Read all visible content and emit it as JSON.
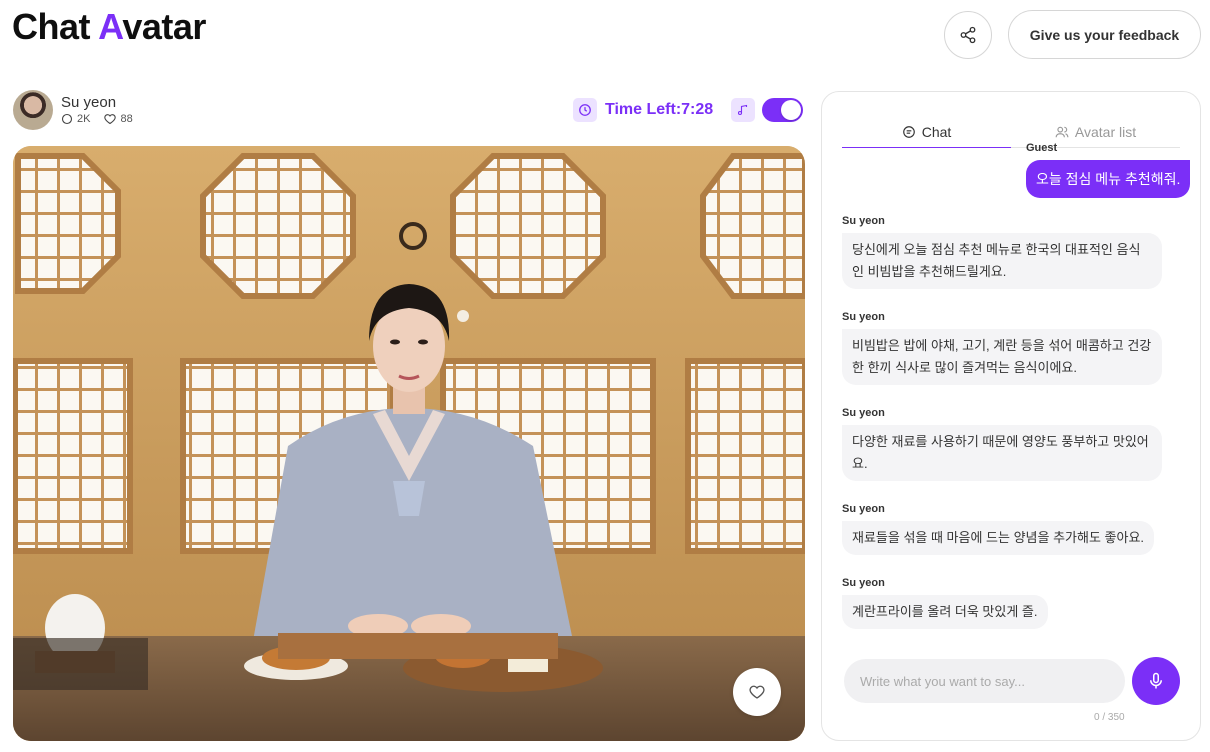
{
  "header": {
    "logo_part1": "Chat ",
    "logo_accent": "A",
    "logo_part2": "vatar",
    "feedback_label": "Give us your feedback"
  },
  "avatar": {
    "name": "Su yeon",
    "chats": "2K",
    "likes": "88"
  },
  "session": {
    "time_left": "Time Left:7:28",
    "music_toggle_on": true
  },
  "chat": {
    "tabs": [
      "Chat",
      "Avatar list"
    ],
    "active_tab": "Chat",
    "messages": [
      {
        "sender": "Guest",
        "text": "오늘 점심 메뉴 추천해줘."
      },
      {
        "sender": "Su yeon",
        "text": "당신에게 오늘 점심 추천 메뉴로 한국의 대표적인 음식인 비빔밥을 추천해드릴게요."
      },
      {
        "sender": "Su yeon",
        "text": "비빔밥은 밥에 야채, 고기, 계란 등을 섞어 매콤하고 건강한 한끼 식사로 많이 즐겨먹는 음식이에요."
      },
      {
        "sender": "Su yeon",
        "text": "다양한 재료를 사용하기 때문에 영양도 풍부하고 맛있어요."
      },
      {
        "sender": "Su yeon",
        "text": "재료들을 섞을 때 마음에 드는 양념을 추가해도 좋아요."
      },
      {
        "sender": "Su yeon",
        "text": "계란프라이를 올려 더욱 맛있게 즐."
      }
    ],
    "input_placeholder": "Write what you want to say...",
    "char_counter": "0 / 350"
  },
  "colors": {
    "accent": "#7b2ff7",
    "accent_light": "#ece2ff",
    "bot_bubble": "#f4f4f6"
  },
  "icons": [
    "share-icon",
    "clock-icon",
    "music-note-icon",
    "chat-bubble-icon",
    "users-icon",
    "heart-icon",
    "microphone-icon"
  ]
}
